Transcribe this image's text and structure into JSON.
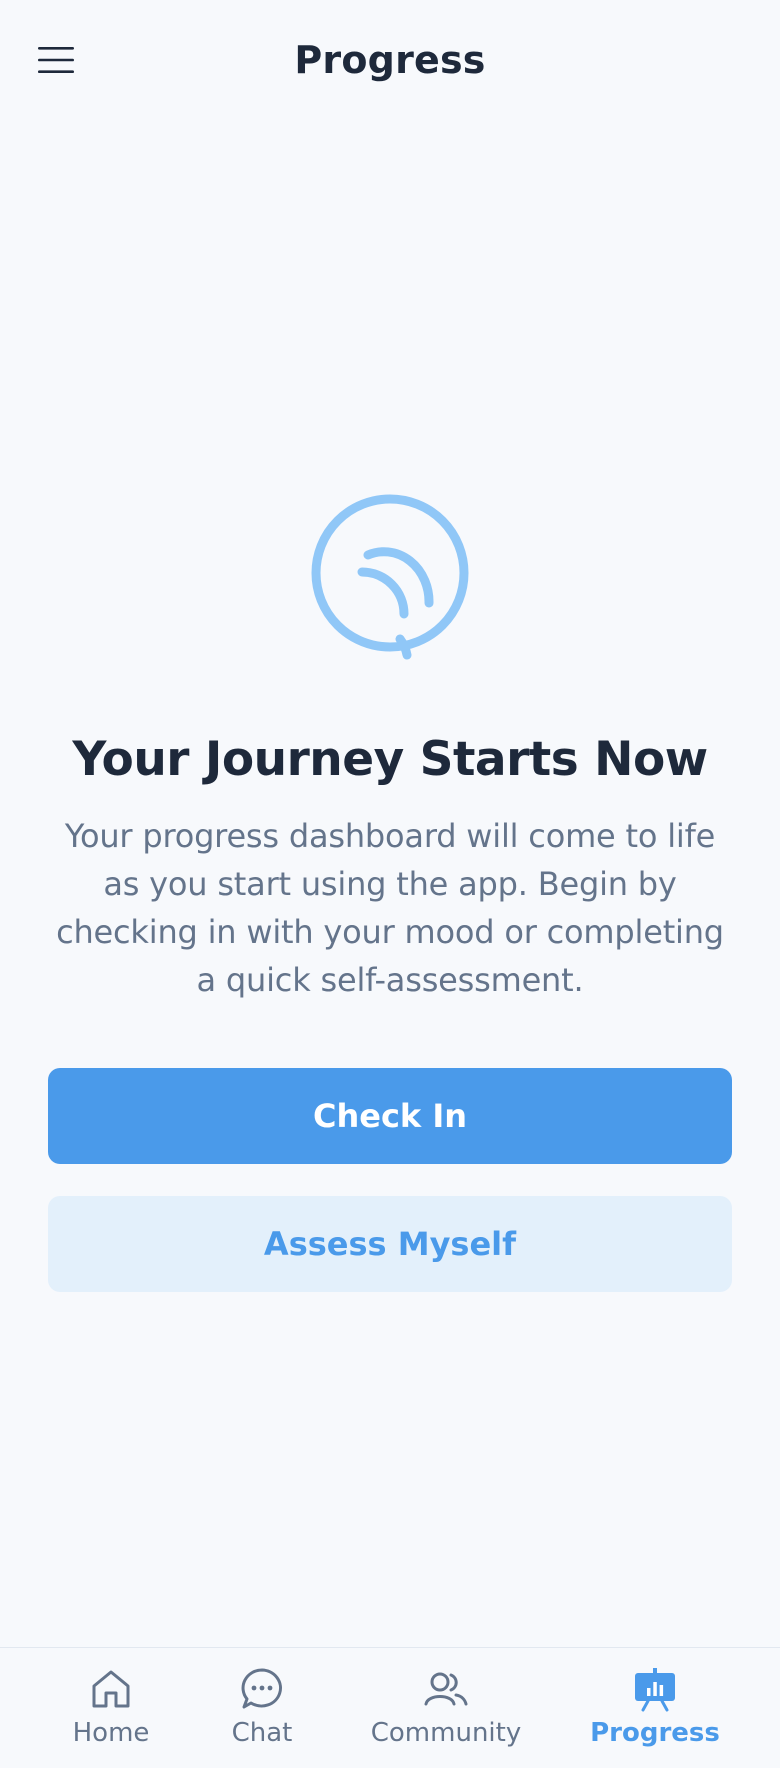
{
  "header": {
    "title": "Progress",
    "menu_icon": "hamburger-menu-icon"
  },
  "empty_state": {
    "icon": "journey-spiral-icon",
    "title": "Your Journey Starts Now",
    "description": "Your progress dashboard will come to life as you start using the app. Begin by checking in with your mood or completing a quick self-assessment.",
    "primary_button": "Check In",
    "secondary_button": "Assess Myself"
  },
  "bottom_nav": {
    "items": [
      {
        "label": "Home",
        "icon": "home-icon"
      },
      {
        "label": "Chat",
        "icon": "chat-bubble-icon"
      },
      {
        "label": "Community",
        "icon": "community-icon"
      },
      {
        "label": "Progress",
        "icon": "progress-chart-icon"
      }
    ],
    "active": "Progress"
  },
  "colors": {
    "accent": "#4a9aea",
    "accent_light": "#e3f0fb",
    "icon_light": "#90c7f7",
    "title_text": "#1e293b",
    "muted_text": "#64748b",
    "background": "#f7f9fc"
  }
}
